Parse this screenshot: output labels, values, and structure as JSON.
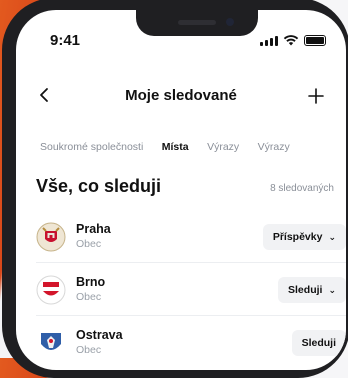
{
  "status": {
    "time": "9:41"
  },
  "header": {
    "title": "Moje sledované",
    "back_icon": "chevron-left-icon",
    "add_icon": "plus-icon"
  },
  "tabs": [
    {
      "label": "Soukromé společnosti",
      "active": false
    },
    {
      "label": "Místa",
      "active": true
    },
    {
      "label": "Výrazy",
      "active": false
    },
    {
      "label": "Výrazy",
      "active": false
    }
  ],
  "section": {
    "title": "Vše, co sleduji",
    "count": "8 sledovaných"
  },
  "places": [
    {
      "name": "Praha",
      "type": "Obec",
      "action": "Příspěvky",
      "has_dropdown": true,
      "crest_icon": "praha-crest-icon"
    },
    {
      "name": "Brno",
      "type": "Obec",
      "action": "Sleduji",
      "has_dropdown": true,
      "crest_icon": "brno-crest-icon"
    },
    {
      "name": "Ostrava",
      "type": "Obec",
      "action": "Sleduji",
      "has_dropdown": false,
      "crest_icon": "ostrava-crest-icon"
    }
  ],
  "colors": {
    "accent": "#f3c7c0",
    "background_orange": "#d9481a"
  }
}
